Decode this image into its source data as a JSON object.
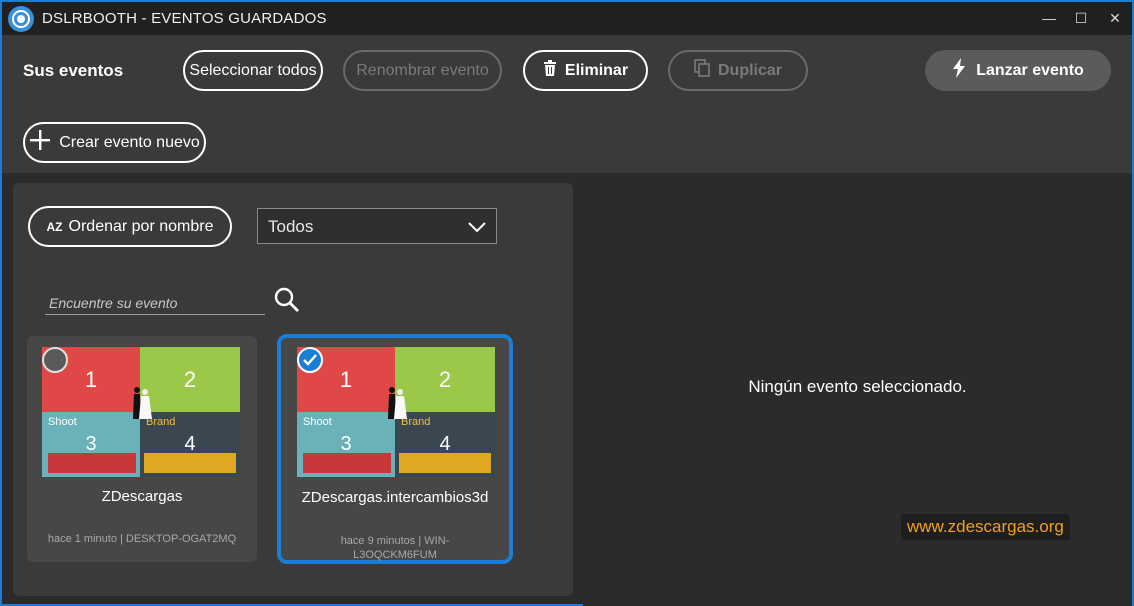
{
  "window": {
    "title": "DSLRBOOTH - EVENTOS GUARDADOS",
    "controls": {
      "minimize": "—",
      "maximize": "☐",
      "close": "✕"
    }
  },
  "toolbar": {
    "title": "Sus eventos",
    "select_all_label": "Seleccionar todos",
    "rename_label": "Renombrar evento",
    "delete_label": "Eliminar",
    "duplicate_label": "Duplicar",
    "launch_label": "Lanzar evento",
    "create_label": "Crear evento nuevo"
  },
  "left_panel": {
    "sort_label": "Ordenar por nombre",
    "sort_icon_text": "AZ",
    "filter": {
      "selected": "Todos"
    },
    "search": {
      "placeholder": "Encuentre su evento",
      "value": ""
    }
  },
  "events": [
    {
      "name": "ZDescargas",
      "meta": "hace 1 minuto | DESKTOP-OGAT2MQ",
      "selected": false,
      "thumb": {
        "q1": "1",
        "q2": "2",
        "q3_label": "Shoot",
        "q3_num": "3",
        "q4_label": "Brand",
        "q4_num": "4"
      }
    },
    {
      "name": "ZDescargas.intercambios3d",
      "meta": "hace 9 minutos | WIN-L3OQCKM6FUM",
      "selected": true,
      "thumb": {
        "q1": "1",
        "q2": "2",
        "q3_label": "Shoot",
        "q3_num": "3",
        "q4_label": "Brand",
        "q4_num": "4"
      }
    }
  ],
  "right_panel": {
    "empty_message": "Ningún evento seleccionado.",
    "watermark": "www.zdescargas.org"
  },
  "colors": {
    "accent": "#1a7fd4",
    "toolbar_bg": "#3a3a3a",
    "background": "#2b2b2b",
    "watermark": "#f0a020"
  }
}
